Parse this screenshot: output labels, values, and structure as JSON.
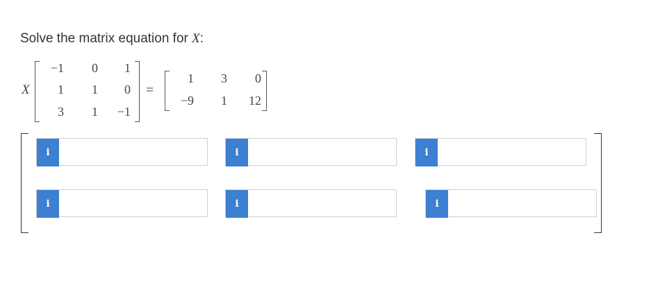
{
  "prompt": {
    "text": "Solve the matrix equation for ",
    "variable": "X",
    "suffix": ":"
  },
  "equation": {
    "variable": "X",
    "equals": "=",
    "left_matrix": [
      [
        "−1",
        "0",
        "1"
      ],
      [
        "1",
        "1",
        "0"
      ],
      [
        "3",
        "1",
        "−1"
      ]
    ],
    "right_matrix": [
      [
        "1",
        "3",
        "0"
      ],
      [
        "−9",
        "1",
        "12"
      ]
    ]
  },
  "answer_grid": {
    "info_icon": "i",
    "rows": [
      [
        {
          "value": ""
        },
        {
          "value": ""
        },
        {
          "value": ""
        }
      ],
      [
        {
          "value": ""
        },
        {
          "value": ""
        },
        {
          "value": ""
        }
      ]
    ]
  },
  "colors": {
    "info_button": "#3d7fd0",
    "input_border": "#cfcfcf"
  }
}
